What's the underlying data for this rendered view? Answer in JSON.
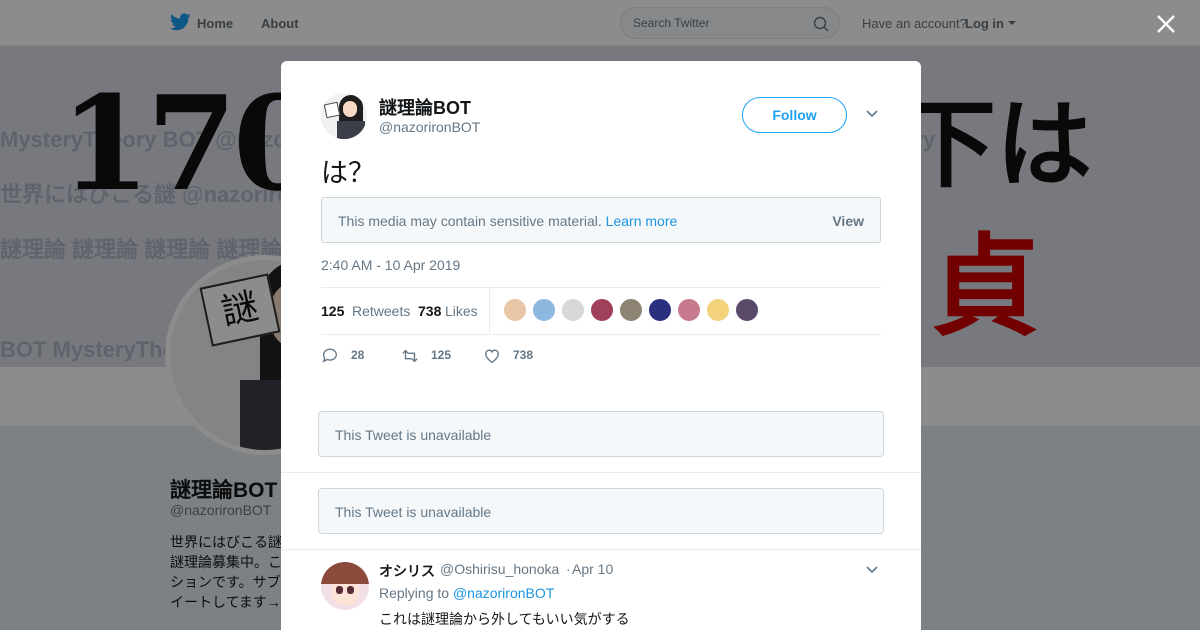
{
  "nav": {
    "home_label": "Home",
    "about_label": "About",
    "search_placeholder": "Search Twitter",
    "have_account": "Have an account?",
    "login_label": "Log in"
  },
  "banner": {
    "left_text": "170",
    "right_top_text": "下は",
    "right_bottom_text": "貞"
  },
  "profile": {
    "name": "謎理論BOT",
    "handle": "@nazorironBOT",
    "bio": "世界にはびこる謎 謎理論募集中。こ ションです。サブ イートしてます→"
  },
  "tweet": {
    "author_name": "謎理論BOT",
    "author_handle": "@nazorironBOT",
    "follow_label": "Follow",
    "text": "は？",
    "sensitive_notice": "This media may contain sensitive material.",
    "learn_more": "Learn more",
    "view_label": "View",
    "timestamp": "2:40 AM - 10 Apr 2019",
    "retweets_count": "125",
    "retweets_label": "Retweets",
    "likes_count": "738",
    "likes_label": "Likes",
    "reply_action_count": "28",
    "retweet_action_count": "125",
    "like_action_count": "738",
    "likers": [
      {
        "color": "#e9c6a5"
      },
      {
        "color": "#8fb8e0"
      },
      {
        "color": "#d8d8d8"
      },
      {
        "color": "#a0405a"
      },
      {
        "color": "#8d8474"
      },
      {
        "color": "#2a2f80"
      },
      {
        "color": "#c77a8e"
      },
      {
        "color": "#f2d27a"
      },
      {
        "color": "#5a4a6a"
      }
    ]
  },
  "unavailable": {
    "first": "This Tweet is unavailable",
    "second": "This Tweet is unavailable"
  },
  "reply": {
    "name": "オシリス",
    "handle": "@Oshirisu_honoka",
    "dot": "·",
    "date": "Apr 10",
    "replying_prefix": "Replying to",
    "replying_to": "@nazorironBOT",
    "text": "これは謎理論から外してもいい気がする"
  },
  "colors": {
    "accent": "#1da1f2",
    "link": "#1b95e0",
    "muted": "#657786"
  }
}
